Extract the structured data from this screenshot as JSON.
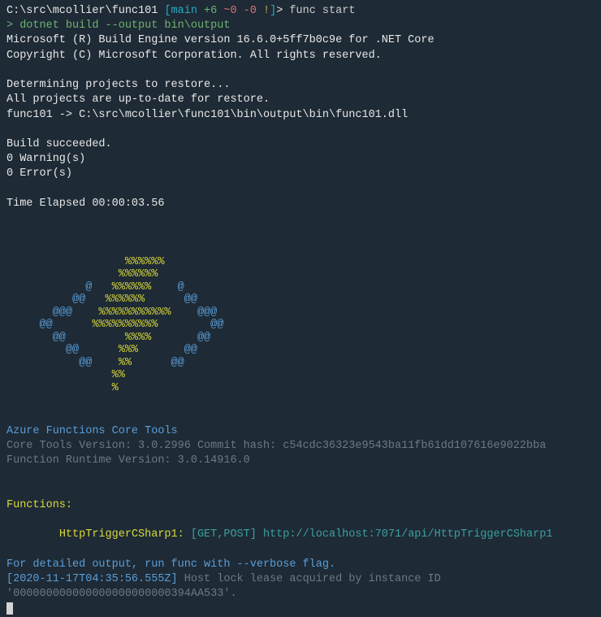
{
  "prompt": {
    "path": "C:\\src\\mcollier\\func101",
    "branch_open": " [",
    "branch": "main",
    "ahead": " +6",
    "behind": " ~0",
    "local": " -0",
    "bang": " !",
    "branch_close": "]",
    "end": "> ",
    "command": "func start"
  },
  "subcommand": "> dotnet build --output bin\\output",
  "build": {
    "line1": "Microsoft (R) Build Engine version 16.6.0+5ff7b0c9e for .NET Core",
    "line2": "Copyright (C) Microsoft Corporation. All rights reserved.",
    "blank": "",
    "restore1": "  Determining projects to restore...",
    "restore2": "  All projects are up-to-date for restore.",
    "restore3": "  func101 -> C:\\src\\mcollier\\func101\\bin\\output\\bin\\func101.dll",
    "succeeded": "Build succeeded.",
    "warnings": "    0 Warning(s)",
    "errors": "    0 Error(s)",
    "elapsed": "Time Elapsed 00:00:03.56"
  },
  "ascii": {
    "l01": "                  %%%%%%",
    "l02": "                 %%%%%%",
    "l03": "            @   %%%%%%    @",
    "l04": "          @@   %%%%%%      @@",
    "l05": "       @@@    %%%%%%%%%%%    @@@",
    "l06": "     @@      %%%%%%%%%%        @@",
    "l07": "       @@         %%%%       @@",
    "l08": "         @@      %%%       @@",
    "l09": "           @@    %%      @@",
    "l10": "                %%",
    "l11": "                %"
  },
  "footer": {
    "title": "Azure Functions Core Tools",
    "core_version_label": "Core Tools Version:       ",
    "core_version_value": "3.0.2996 Commit hash: c54cdc36323e9543ba11fb61dd107616e9022bba",
    "runtime_label": "Function Runtime Version: ",
    "runtime_value": "3.0.14916.0"
  },
  "functions": {
    "header": "Functions:",
    "indent": "        ",
    "name": "HttpTriggerCSharp1:",
    "methods": " [GET,POST] ",
    "url": "http://localhost:7071/api/HttpTriggerCSharp1"
  },
  "tail": {
    "verbose": "For detailed output, run func with --verbose flag.",
    "log_ts": "[2020-11-17T04:35:56.555Z] ",
    "log_msg": "Host lock lease acquired by instance ID '000000000000000000000000394AA533'."
  }
}
